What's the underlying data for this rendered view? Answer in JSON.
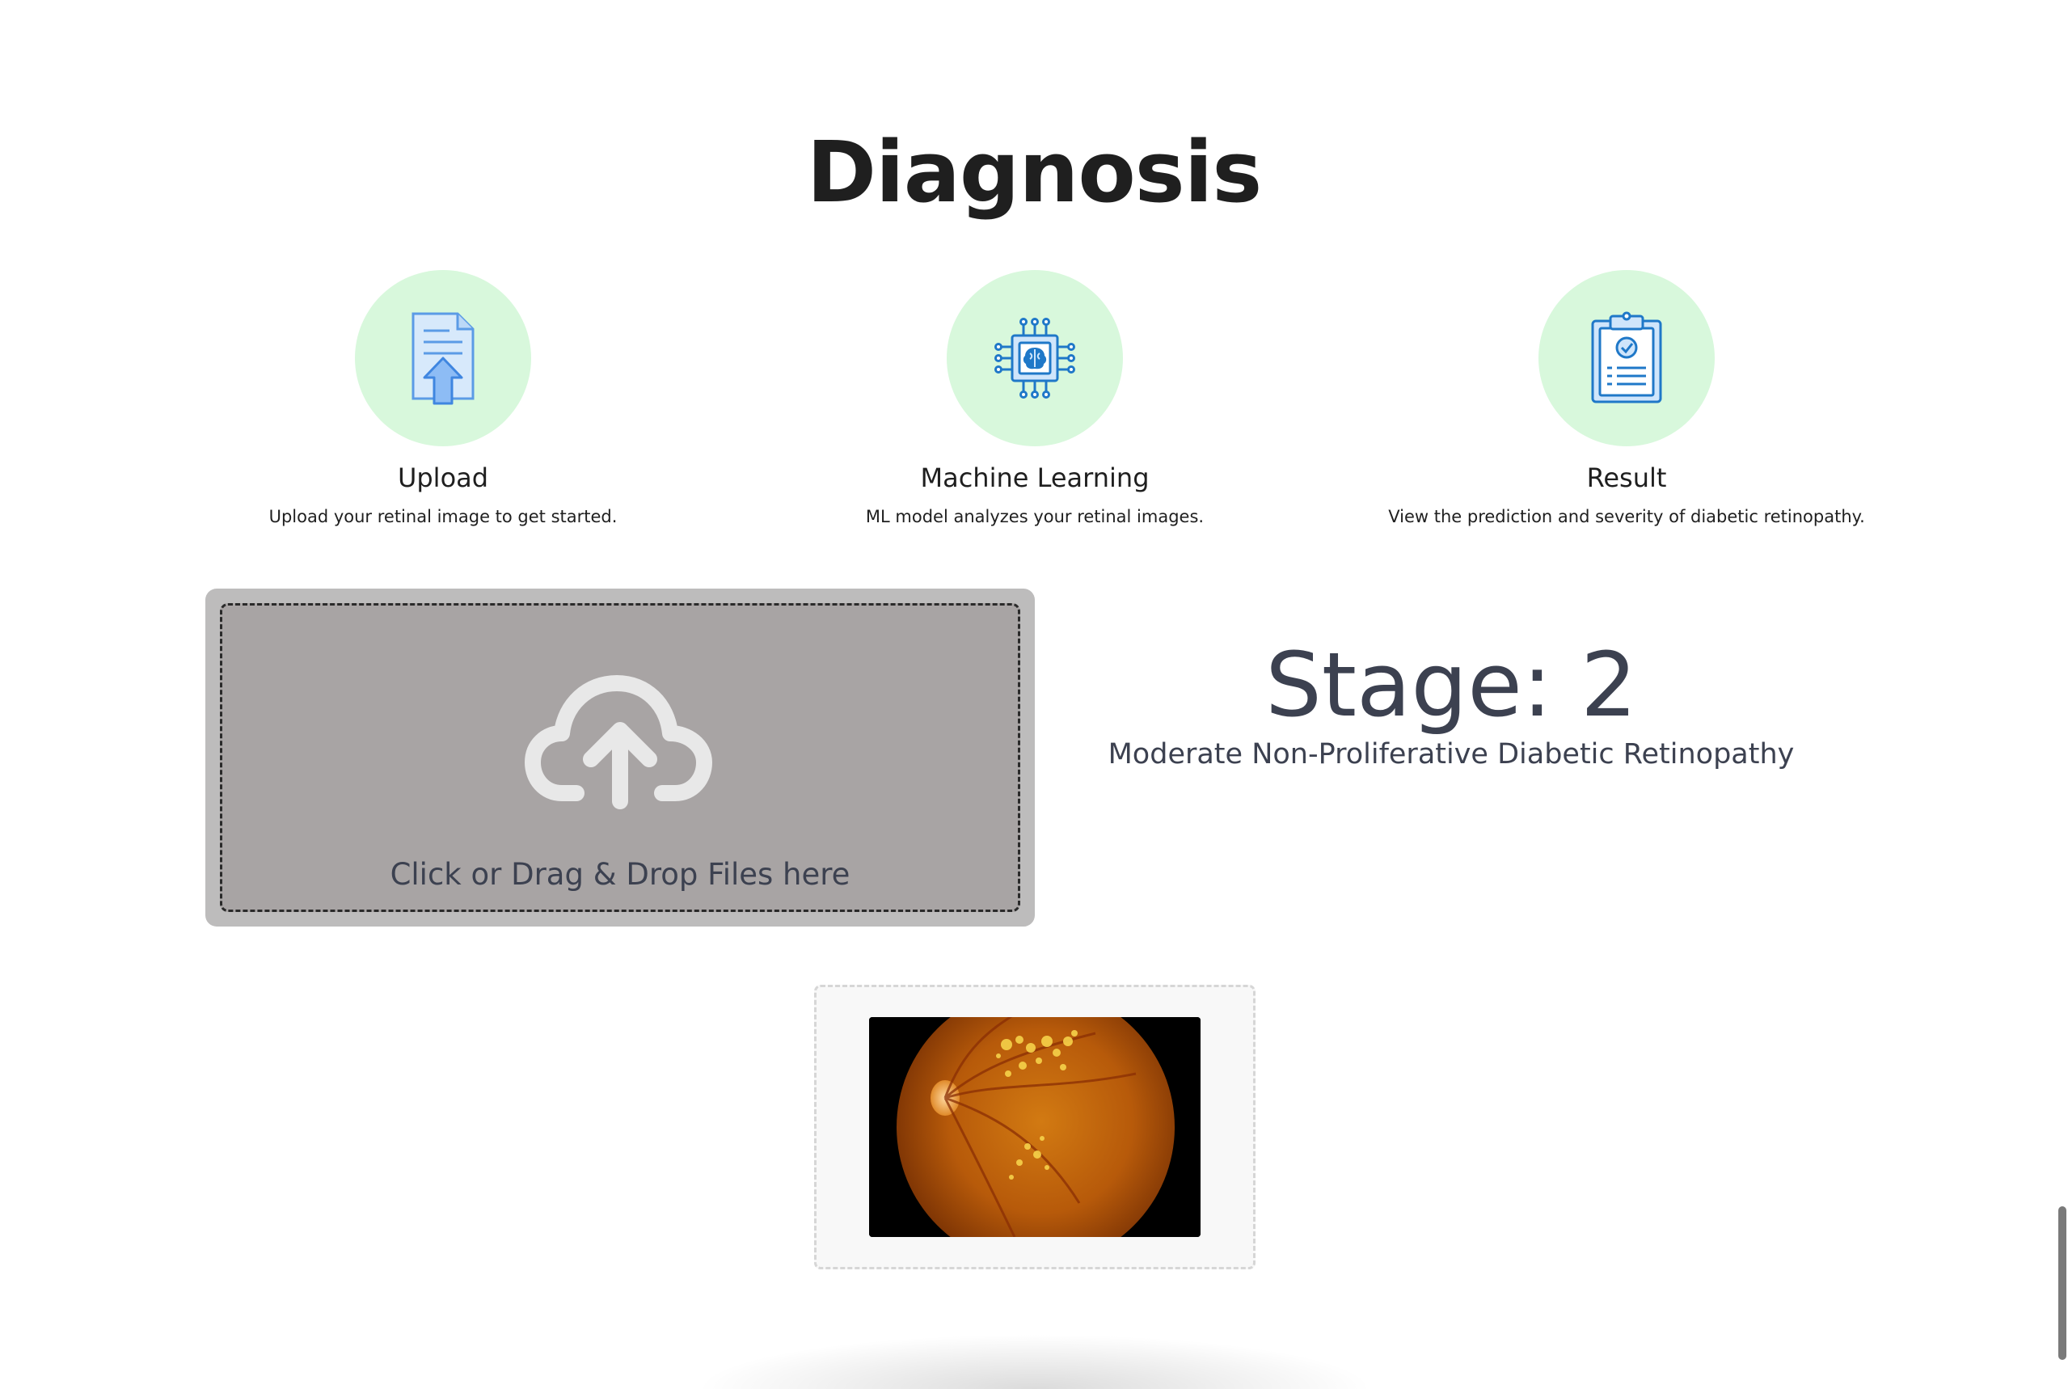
{
  "page": {
    "title": "Diagnosis"
  },
  "steps": [
    {
      "title": "Upload",
      "description": "Upload your retinal image to get started.",
      "icon": "document-upload-icon"
    },
    {
      "title": "Machine Learning",
      "description": "ML model analyzes your retinal images.",
      "icon": "ai-brain-chip-icon"
    },
    {
      "title": "Result",
      "description": "View the prediction and severity of diabetic retinopathy.",
      "icon": "clipboard-report-icon"
    }
  ],
  "upload": {
    "label": "Click or Drag & Drop Files here",
    "icon": "cloud-upload-icon"
  },
  "result": {
    "stage": "Stage: 2",
    "description": "Moderate Non-Proliferative Diabetic Retinopathy"
  },
  "colors": {
    "step_circle": "#d8f8dc",
    "icon_blue": "#1f78c8",
    "dropzone_outer": "#bdbcbc",
    "dropzone_inner": "#a8a4a4",
    "result_text": "#3c4150"
  }
}
